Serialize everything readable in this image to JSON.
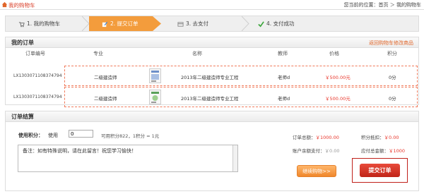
{
  "header": {
    "site_title": "我的购物车",
    "breadcrumb_prefix": "您当前的位置：",
    "breadcrumb_home": "首页",
    "breadcrumb_sep": "＞",
    "breadcrumb_current": "我的购物车"
  },
  "steps": [
    {
      "label": "1. 我的购物车",
      "icon": "cart-icon"
    },
    {
      "label": "2. 提交订单",
      "icon": "pencil-icon"
    },
    {
      "label": "3. 去支付",
      "icon": "card-icon"
    },
    {
      "label": "4. 支付成功",
      "icon": "check-icon"
    }
  ],
  "orders": {
    "title": "我的订单",
    "modify_link": "返回购物车修改商品",
    "columns": [
      "订单编号",
      "专业",
      "名称",
      "教师",
      "价格",
      "积分"
    ],
    "rows": [
      {
        "id": "LX1303071108374794",
        "major": "二级建造师",
        "name": "2013年二级建造师专业工程",
        "teacher": "老师d",
        "price": "￥500.00元",
        "points": "0分"
      },
      {
        "id": "LX1303071108374794",
        "major": "二级建造师",
        "name": "2013年二级建造师专业工程",
        "teacher": "老师d",
        "price": "￥500.00元",
        "points": "0分"
      }
    ]
  },
  "settle": {
    "title": "订单结算",
    "points_label": "使用积分：",
    "points_use": "使用",
    "points_value": "0",
    "points_available": "可用积分822，1积分 = 1元",
    "remark": "备注：如有特殊说明，请在此留言！祝您学习愉快！",
    "order_total_label": "订单总额：",
    "order_total_value": "￥1000.00",
    "points_deduct_label": "积分抵扣：",
    "points_deduct_value": "￥0.00",
    "balance_label": "账户余额支付：",
    "balance_value": "￥0.00",
    "payable_label": "应付总金额：",
    "payable_value": "￥1000",
    "continue_button": "继续购物>>",
    "submit_button": "提交订单"
  },
  "colors": {
    "accent_orange": "#f39c3c",
    "price_red": "#e8352a",
    "submit_red": "#c02418"
  }
}
